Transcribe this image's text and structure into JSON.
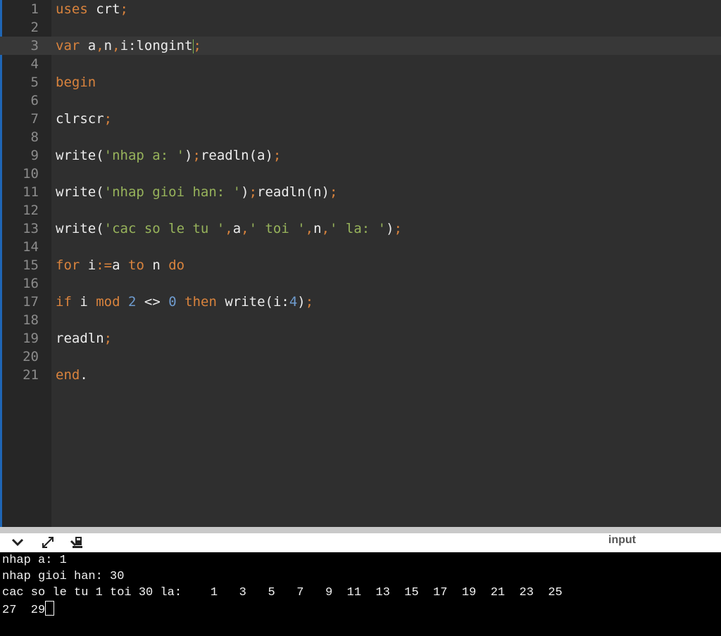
{
  "editor": {
    "lines": [
      {
        "n": "1",
        "seg": [
          [
            "kw",
            "uses"
          ],
          [
            "t",
            " crt"
          ],
          [
            "pn",
            ";"
          ]
        ]
      },
      {
        "n": "2",
        "seg": []
      },
      {
        "n": "3",
        "seg": [
          [
            "kw",
            "var"
          ],
          [
            "t",
            " a"
          ],
          [
            "pn",
            ","
          ],
          [
            "t",
            "n"
          ],
          [
            "pn",
            ","
          ],
          [
            "t",
            "i:longint"
          ],
          [
            "pn",
            ";"
          ]
        ]
      },
      {
        "n": "4",
        "seg": []
      },
      {
        "n": "5",
        "seg": [
          [
            "kw",
            "begin"
          ]
        ]
      },
      {
        "n": "6",
        "seg": []
      },
      {
        "n": "7",
        "seg": [
          [
            "t",
            "clrscr"
          ],
          [
            "pn",
            ";"
          ]
        ]
      },
      {
        "n": "8",
        "seg": []
      },
      {
        "n": "9",
        "seg": [
          [
            "t",
            "write("
          ],
          [
            "str",
            "'nhap a: '"
          ],
          [
            "t",
            ")"
          ],
          [
            "pn",
            ";"
          ],
          [
            "t",
            "readln(a)"
          ],
          [
            "pn",
            ";"
          ]
        ]
      },
      {
        "n": "10",
        "seg": []
      },
      {
        "n": "11",
        "seg": [
          [
            "t",
            "write("
          ],
          [
            "str",
            "'nhap gioi han: '"
          ],
          [
            "t",
            ")"
          ],
          [
            "pn",
            ";"
          ],
          [
            "t",
            "readln(n)"
          ],
          [
            "pn",
            ";"
          ]
        ]
      },
      {
        "n": "12",
        "seg": []
      },
      {
        "n": "13",
        "seg": [
          [
            "t",
            "write("
          ],
          [
            "str",
            "'cac so le tu '"
          ],
          [
            "pn",
            ","
          ],
          [
            "t",
            "a"
          ],
          [
            "pn",
            ","
          ],
          [
            "str",
            "' toi '"
          ],
          [
            "pn",
            ","
          ],
          [
            "t",
            "n"
          ],
          [
            "pn",
            ","
          ],
          [
            "str",
            "' la: '"
          ],
          [
            "t",
            ")"
          ],
          [
            "pn",
            ";"
          ]
        ]
      },
      {
        "n": "14",
        "seg": []
      },
      {
        "n": "15",
        "seg": [
          [
            "kw",
            "for"
          ],
          [
            "t",
            " i"
          ],
          [
            "pn",
            ":="
          ],
          [
            "t",
            "a "
          ],
          [
            "kw",
            "to"
          ],
          [
            "t",
            " n "
          ],
          [
            "kw",
            "do"
          ]
        ]
      },
      {
        "n": "16",
        "seg": []
      },
      {
        "n": "17",
        "seg": [
          [
            "kw",
            "if"
          ],
          [
            "t",
            " i "
          ],
          [
            "kw",
            "mod"
          ],
          [
            "t",
            " "
          ],
          [
            "num",
            "2"
          ],
          [
            "t",
            " <> "
          ],
          [
            "num",
            "0"
          ],
          [
            "t",
            " "
          ],
          [
            "kw",
            "then"
          ],
          [
            "t",
            " write(i:"
          ],
          [
            "num",
            "4"
          ],
          [
            "t",
            ")"
          ],
          [
            "pn",
            ";"
          ]
        ]
      },
      {
        "n": "18",
        "seg": []
      },
      {
        "n": "19",
        "seg": [
          [
            "t",
            "readln"
          ],
          [
            "pn",
            ";"
          ]
        ]
      },
      {
        "n": "20",
        "seg": []
      },
      {
        "n": "21",
        "seg": [
          [
            "kw",
            "end"
          ],
          [
            "t",
            "."
          ]
        ]
      }
    ],
    "active_line": "3"
  },
  "toolbar": {
    "input_label": "input",
    "icons": [
      "chevron-down-icon",
      "expand-icon",
      "clear-console-icon"
    ]
  },
  "console": {
    "lines": [
      "nhap a: 1",
      "nhap gioi han: 30",
      "cac so le tu 1 toi 30 la:    1   3   5   7   9  11  13  15  17  19  21  23  25",
      "27  29"
    ]
  },
  "colors": {
    "keyword": "#d9833d",
    "string": "#97b35b",
    "number": "#6f9ccf",
    "text": "#ececec",
    "background": "#2f2f2f"
  }
}
